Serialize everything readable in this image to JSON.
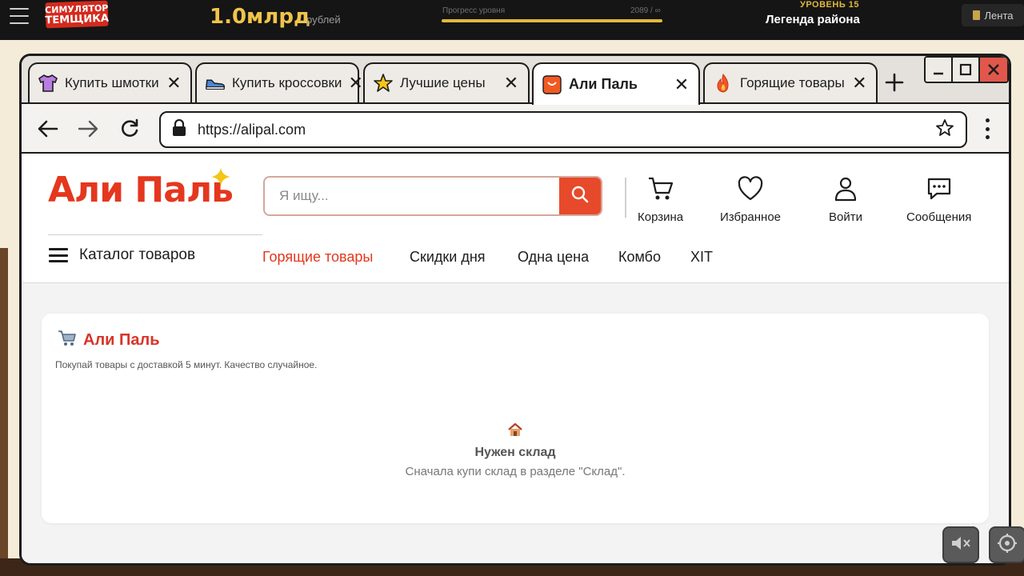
{
  "hud": {
    "logo_line1": "СИМУЛЯТОР",
    "logo_line2": "ТЕМЩИКА",
    "money": "1.0млрд",
    "money_unit": "рублей",
    "progress_label": "Прогресс уровня",
    "progress_value": "2089 / ∞",
    "progress_fraction": 1.0,
    "level": "УРОВЕНЬ 15",
    "rank": "Легенда района",
    "feed_label": "Лента"
  },
  "browser": {
    "tabs": [
      {
        "label": "Купить шмотки",
        "icon": "tshirt-icon",
        "active": false
      },
      {
        "label": "Купить кроссовки",
        "icon": "sneaker-icon",
        "active": false
      },
      {
        "label": "Лучшие цены",
        "icon": "star-icon",
        "active": false
      },
      {
        "label": "Али Паль",
        "icon": "shop-bag-icon",
        "active": true
      },
      {
        "label": "Горящие товары",
        "icon": "fire-icon",
        "active": false
      }
    ],
    "url": "https://alipal.com"
  },
  "site": {
    "logo": "Али Паль",
    "search_placeholder": "Я ищу...",
    "actions": {
      "cart": "Корзина",
      "favorites": "Избранное",
      "login": "Войти",
      "messages": "Сообщения"
    },
    "catalog": "Каталог товаров",
    "menu": [
      "Горящие товары",
      "Скидки дня",
      "Одна цена",
      "Комбо",
      "XIT"
    ]
  },
  "card": {
    "title": "Али Паль",
    "subtitle": "Покупай товары с доставкой 5 минут. Качество случайное.",
    "empty_title": "Нужен склад",
    "empty_text": "Сначала купи склад в разделе \"Склад\"."
  },
  "colors": {
    "brand": "#e4371e",
    "hud_gold": "#e0b83e",
    "hud_bg": "#151515"
  }
}
